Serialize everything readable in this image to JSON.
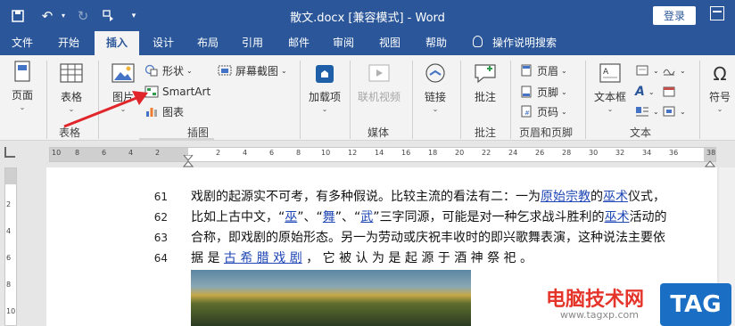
{
  "window": {
    "title": "散文.docx [兼容模式]  -  Word",
    "login_button": "登录"
  },
  "tabs": [
    "文件",
    "开始",
    "插入",
    "设计",
    "布局",
    "引用",
    "邮件",
    "审阅",
    "视图",
    "帮助"
  ],
  "active_tab": "插入",
  "tell_me": "操作说明搜索",
  "ribbon": {
    "pages": "页面",
    "table": "表格",
    "table_group": "表格",
    "pictures": "图片",
    "shapes": "形状",
    "smartart": "SmartArt",
    "chart": "图表",
    "screenshot": "屏幕截图",
    "illustrations_group": "插图",
    "addins": "加载项",
    "online_video": "联机视频",
    "media_group": "媒体",
    "link": "链接",
    "comment": "批注",
    "comment_group": "批注",
    "header": "页眉",
    "footer": "页脚",
    "page_number": "页码",
    "header_footer_group": "页眉和页脚",
    "textbox": "文本框",
    "text_group": "文本",
    "symbol": "符号"
  },
  "ruler": {
    "h_ticks": [
      "10",
      "8",
      "6",
      "4",
      "2",
      "2",
      "4",
      "6",
      "8",
      "10",
      "12",
      "14",
      "16",
      "18",
      "20",
      "22",
      "24",
      "26",
      "28",
      "30",
      "32",
      "34",
      "36",
      "38"
    ],
    "v_ticks": [
      "2",
      "4",
      "6",
      "8",
      "10"
    ]
  },
  "document": {
    "lines": [
      {
        "num": "61",
        "segments": [
          {
            "t": "戏剧的起源实不可考，有多种假说。比较主流的看法有二：一为"
          },
          {
            "t": "原始宗教",
            "link": true
          },
          {
            "t": "的"
          },
          {
            "t": "巫术",
            "link": true
          },
          {
            "t": "仪式，"
          }
        ]
      },
      {
        "num": "62",
        "segments": [
          {
            "t": "比如上古中文，“"
          },
          {
            "t": "巫",
            "link": true
          },
          {
            "t": "”、“"
          },
          {
            "t": "舞",
            "link": true
          },
          {
            "t": "”、“"
          },
          {
            "t": "武",
            "link": true
          },
          {
            "t": "”三字同源，可能是对一种乞求战斗胜利的"
          },
          {
            "t": "巫术",
            "link": true
          },
          {
            "t": "活动的"
          }
        ]
      },
      {
        "num": "63",
        "segments": [
          {
            "t": "合称，即戏剧的原始形态。另一为劳动或庆祝丰收时的即兴歌舞表演，这种说法主要依"
          }
        ]
      },
      {
        "num": "64",
        "segments": [
          {
            "t": "据 是 "
          },
          {
            "t": "古 希 腊 戏 剧",
            "link": true
          },
          {
            "t": " ， 它 被 认 为 是 起 源 于 酒 神 祭 祀 。"
          }
        ]
      }
    ]
  },
  "watermark": {
    "text": "电脑技术网",
    "url": "www.tagxp.com",
    "tag": "TAG"
  },
  "colors": {
    "titlebar": "#2b579a",
    "link": "#1f47b5",
    "arrow": "#e0262a"
  }
}
